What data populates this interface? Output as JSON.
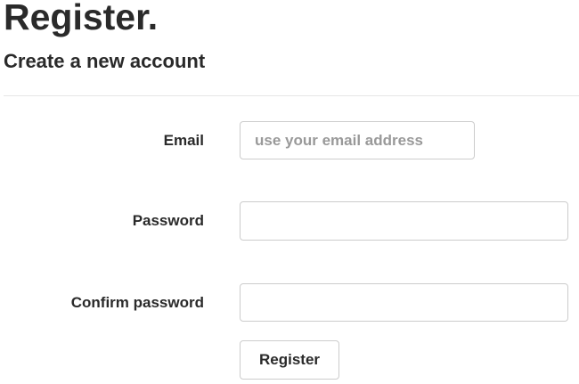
{
  "header": {
    "title": "Register.",
    "subtitle": "Create a new account"
  },
  "form": {
    "email": {
      "label": "Email",
      "value": "",
      "placeholder": "use your email address"
    },
    "password": {
      "label": "Password",
      "value": ""
    },
    "confirm_password": {
      "label": "Confirm password",
      "value": ""
    },
    "submit_label": "Register"
  }
}
